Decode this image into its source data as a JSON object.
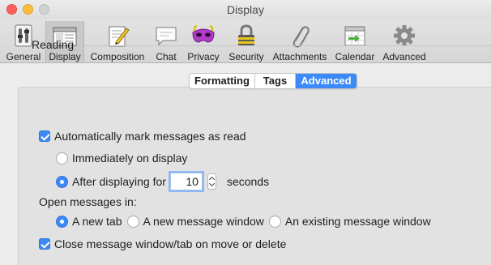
{
  "window": {
    "title": "Display"
  },
  "toolbar": {
    "items": [
      {
        "label": "General",
        "icon": "general-switch-icon"
      },
      {
        "label": "Display",
        "icon": "display-window-icon"
      },
      {
        "label": "Composition",
        "icon": "pencil-paper-icon"
      },
      {
        "label": "Chat",
        "icon": "chat-bubble-icon"
      },
      {
        "label": "Privacy",
        "icon": "mask-icon"
      },
      {
        "label": "Security",
        "icon": "padlock-icon"
      },
      {
        "label": "Attachments",
        "icon": "paperclip-icon"
      },
      {
        "label": "Calendar",
        "icon": "calendar-icon"
      },
      {
        "label": "Advanced",
        "icon": "gear-icon"
      }
    ],
    "selected": "Display"
  },
  "tabs": {
    "items": [
      {
        "label": "Formatting"
      },
      {
        "label": "Tags"
      },
      {
        "label": "Advanced"
      }
    ],
    "active": "Advanced"
  },
  "reading": {
    "section_title": "Reading",
    "auto_mark_label": "Automatically mark messages as read",
    "auto_mark_checked": true,
    "immediately_label": "Immediately on display",
    "immediately_selected": false,
    "after_label": "After displaying for",
    "after_selected": true,
    "delay_value": "10",
    "seconds_label": "seconds",
    "open_in_label": "Open messages in:",
    "open_options": [
      {
        "label": "A new tab",
        "selected": true
      },
      {
        "label": "A new message window",
        "selected": false
      },
      {
        "label": "An existing message window",
        "selected": false
      }
    ],
    "close_label": "Close message window/tab on move or delete",
    "close_checked": true
  },
  "colors": {
    "accent": "#3b8af7",
    "close": "#fc605c",
    "minimize": "#fdbc40"
  }
}
